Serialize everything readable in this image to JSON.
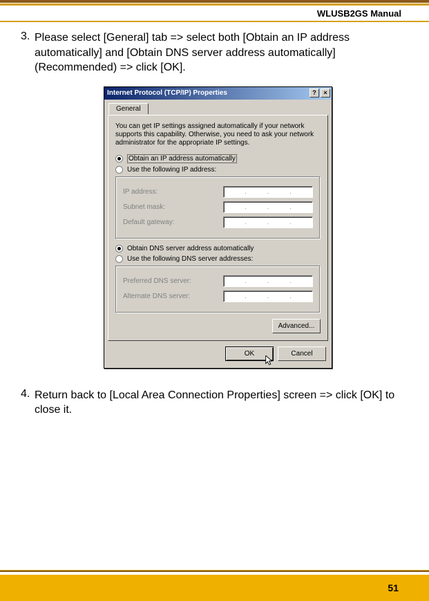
{
  "header": {
    "doc_title": "WLUSB2GS Manual"
  },
  "steps": {
    "s3": {
      "num": "3.",
      "text": "Please select [General] tab => select both [Obtain an IP address automatically] and [Obtain DNS server address automatically] (Recommended) => click [OK]."
    },
    "s4": {
      "num": "4.",
      "text": "Return back to [Local Area Connection Properties] screen => click [OK] to close it."
    }
  },
  "dialog": {
    "title": "Internet Protocol (TCP/IP) Properties",
    "help_btn": "?",
    "close_btn": "×",
    "tab_general": "General",
    "intro": "You can get IP settings assigned automatically if your network supports this capability. Otherwise, you need to ask your network administrator for the appropriate IP settings.",
    "opt_obtain_ip": "Obtain an IP address automatically",
    "opt_use_ip": "Use the following IP address:",
    "lbl_ip": "IP address:",
    "lbl_subnet": "Subnet mask:",
    "lbl_gateway": "Default gateway:",
    "opt_obtain_dns": "Obtain DNS server address automatically",
    "opt_use_dns": "Use the following DNS server addresses:",
    "lbl_pref_dns": "Preferred DNS server:",
    "lbl_alt_dns": "Alternate DNS server:",
    "btn_advanced": "Advanced...",
    "btn_ok": "OK",
    "btn_cancel": "Cancel"
  },
  "footer": {
    "page_number": "51"
  }
}
